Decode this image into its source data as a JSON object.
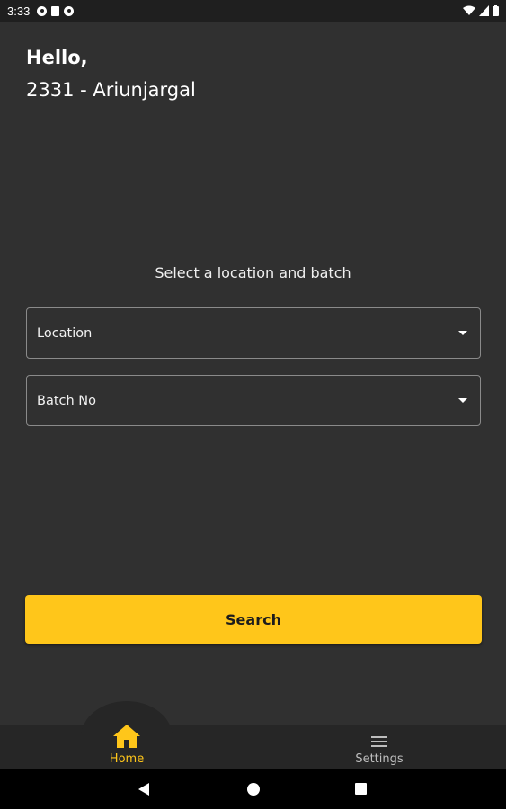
{
  "status_bar": {
    "time": "3:33"
  },
  "header": {
    "greeting": "Hello,",
    "user": "2331 - Ariunjargal"
  },
  "main": {
    "prompt": "Select a location and batch",
    "location_placeholder": "Location",
    "batch_placeholder": "Batch No",
    "search_label": "Search"
  },
  "bottom_nav": {
    "items": [
      {
        "label": "Home",
        "icon": "home-icon",
        "active": true
      },
      {
        "label": "Settings",
        "icon": "menu-icon",
        "active": false
      }
    ]
  },
  "colors": {
    "accent": "#ffc61a",
    "background": "#303030",
    "nav_background": "#262626"
  }
}
